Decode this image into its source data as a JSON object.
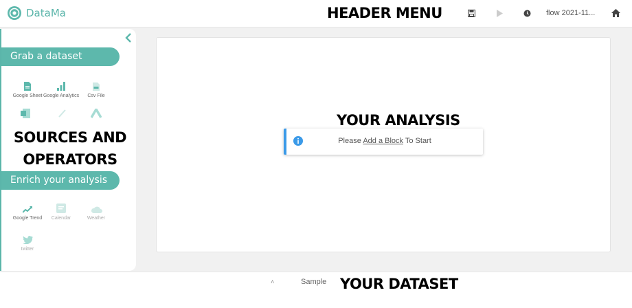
{
  "header": {
    "logo_text": "DataMa",
    "menu_label": "HEADER MENU",
    "flow_name": "flow 2021-11...",
    "icons": [
      "save-icon",
      "play-icon",
      "history-icon",
      "home-icon"
    ]
  },
  "sidebar": {
    "overlay_label_line1": "SOURCES AND",
    "overlay_label_line2": "OPERATORS",
    "section1_title": "Grab a dataset",
    "section2_title": "Enrich your analysis",
    "sources": [
      {
        "label": "Google Sheet",
        "icon": "google-sheet-icon"
      },
      {
        "label": "Google Analytics",
        "icon": "google-analytics-icon"
      },
      {
        "label": "Csv File",
        "icon": "csv-file-icon"
      }
    ],
    "enrich": [
      {
        "label": "Google Trend",
        "icon": "trend-icon"
      },
      {
        "label": "Calendar",
        "icon": "calendar-icon"
      },
      {
        "label": "Weather",
        "icon": "cloud-icon"
      },
      {
        "label": "twitter",
        "icon": "twitter-icon"
      }
    ]
  },
  "main": {
    "overlay_label": "YOUR ANALYSIS",
    "notice_prefix": "Please ",
    "notice_link": "Add a Block",
    "notice_suffix": " To Start"
  },
  "footer": {
    "overlay_label": "YOUR DATASET",
    "caret": "˄",
    "tab_label": "Sample"
  },
  "colors": {
    "accent": "#5db8ac",
    "info": "#3b9ae8"
  }
}
